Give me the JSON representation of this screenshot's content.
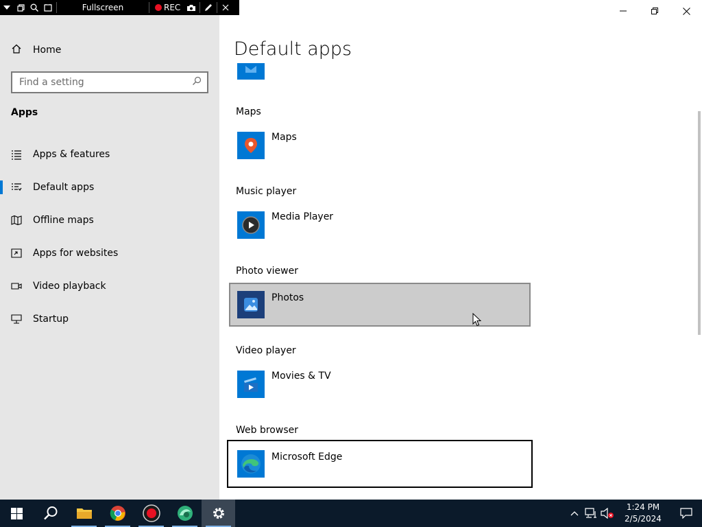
{
  "recorder": {
    "fullscreen_label": "Fullscreen",
    "rec_label": "REC"
  },
  "sidebar": {
    "home_label": "Home",
    "search_placeholder": "Find a setting",
    "section_title": "Apps",
    "items": [
      {
        "label": "Apps & features",
        "icon": "list-icon"
      },
      {
        "label": "Default apps",
        "icon": "default-apps-icon",
        "selected": true
      },
      {
        "label": "Offline maps",
        "icon": "map-icon"
      },
      {
        "label": "Apps for websites",
        "icon": "link-window-icon"
      },
      {
        "label": "Video playback",
        "icon": "video-icon"
      },
      {
        "label": "Startup",
        "icon": "startup-icon"
      }
    ]
  },
  "main": {
    "title": "Default apps",
    "categories": [
      {
        "label": "Maps",
        "app": "Maps"
      },
      {
        "label": "Music player",
        "app": "Media Player"
      },
      {
        "label": "Photo viewer",
        "app": "Photos"
      },
      {
        "label": "Video player",
        "app": "Movies & TV"
      },
      {
        "label": "Web browser",
        "app": "Microsoft Edge"
      }
    ]
  },
  "taskbar": {
    "time": "1:24 PM",
    "date": "2/5/2024"
  },
  "colors": {
    "accent": "#0078d4",
    "sidebar_bg": "#e6e6e6",
    "taskbar_bg": "#0b1a2a",
    "hover_bg": "#cccccc"
  }
}
